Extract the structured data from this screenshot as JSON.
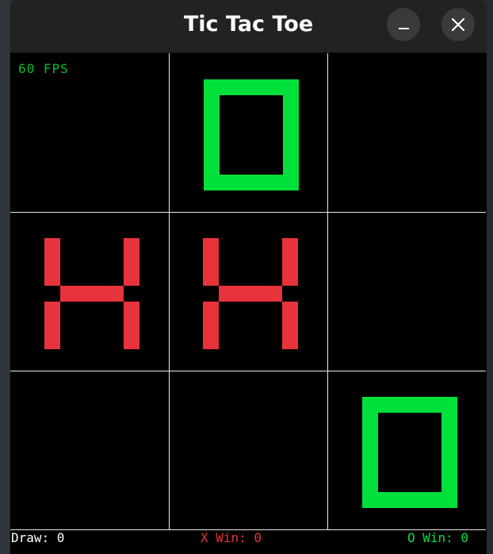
{
  "window": {
    "title": "Tic Tac Toe"
  },
  "hud": {
    "fps": "60 FPS"
  },
  "board": {
    "cells": [
      "",
      "O",
      "",
      "X",
      "X",
      "",
      "",
      "",
      "O"
    ]
  },
  "scores": {
    "draw_label": "Draw: 0",
    "x_win_label": "X Win: 0",
    "o_win_label": "O Win: 0"
  },
  "colors": {
    "x_mark": "#e8323c",
    "o_mark": "#00e03a",
    "grid": "#e8e8e8",
    "fps_text": "#00c030"
  },
  "icons": {
    "minimize": "minimize-icon",
    "close": "close-icon"
  }
}
